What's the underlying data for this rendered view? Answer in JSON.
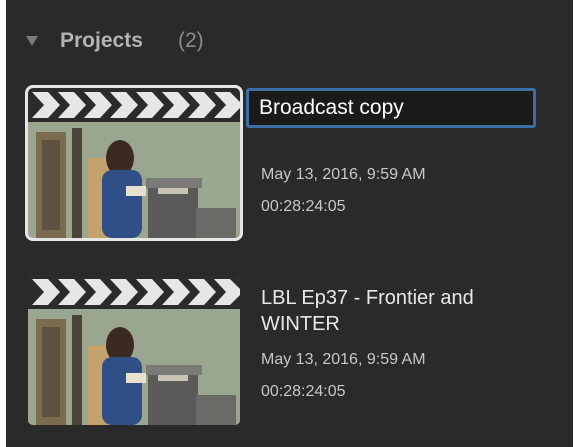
{
  "section": {
    "title": "Projects",
    "count": "(2)"
  },
  "projects": [
    {
      "name": "Broadcast copy",
      "date": "May 13, 2016, 9:59 AM",
      "duration": "00:28:24:05",
      "selected": true
    },
    {
      "name_line1": "LBL Ep37 - Frontier and",
      "name_line2": "WINTER",
      "date": "May 13, 2016, 9:59 AM",
      "duration": "00:28:24:05",
      "selected": false
    }
  ],
  "icons": {
    "disclosure": "disclosure-triangle-down-icon",
    "clapper": "clapperboard-icon"
  },
  "colors": {
    "panel_bg": "#2a2a2a",
    "edit_border": "#3a6ea5",
    "selection_outline": "#e6e6e6"
  }
}
